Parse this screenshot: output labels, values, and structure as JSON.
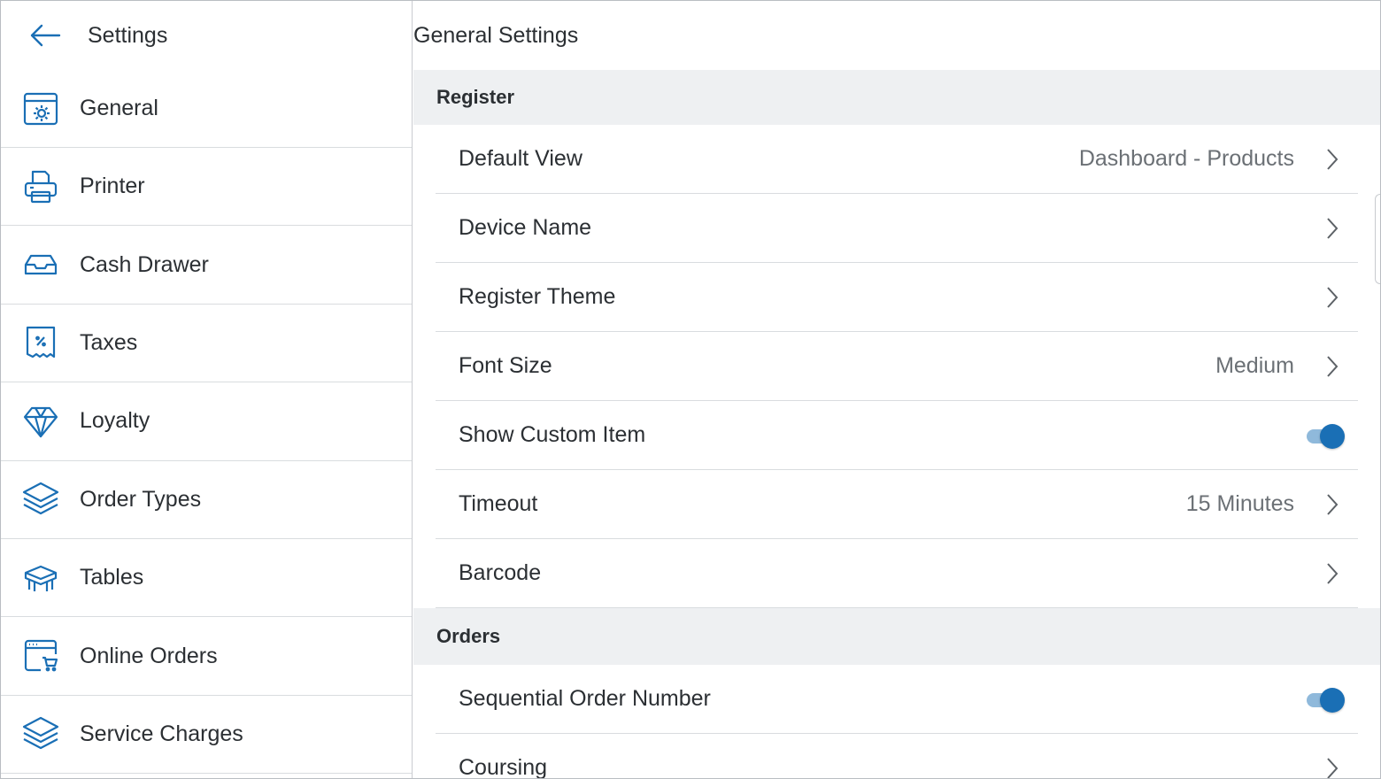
{
  "sidebar": {
    "title": "Settings",
    "items": [
      {
        "label": "General",
        "icon": "general-settings-icon"
      },
      {
        "label": "Printer",
        "icon": "printer-icon"
      },
      {
        "label": "Cash Drawer",
        "icon": "cash-drawer-icon"
      },
      {
        "label": "Taxes",
        "icon": "tax-receipt-icon"
      },
      {
        "label": "Loyalty",
        "icon": "diamond-icon"
      },
      {
        "label": "Order Types",
        "icon": "layers-icon"
      },
      {
        "label": "Tables",
        "icon": "table-icon"
      },
      {
        "label": "Online Orders",
        "icon": "online-cart-icon"
      },
      {
        "label": "Service Charges",
        "icon": "layers-icon"
      }
    ]
  },
  "main": {
    "title": "General Settings",
    "register": {
      "header": "Register",
      "rows": [
        {
          "label": "Default View",
          "value": "Dashboard - Products"
        },
        {
          "label": "Device Name",
          "value": ""
        },
        {
          "label": "Register Theme",
          "value": ""
        },
        {
          "label": "Font Size",
          "value": "Medium"
        },
        {
          "label": "Show Custom Item",
          "toggle": true
        },
        {
          "label": "Timeout",
          "value": "15 Minutes"
        },
        {
          "label": "Barcode",
          "value": ""
        }
      ]
    },
    "orders": {
      "header": "Orders",
      "rows": [
        {
          "label": "Sequential Order Number",
          "toggle": true
        },
        {
          "label": "Coursing",
          "value": ""
        }
      ]
    }
  },
  "colors": {
    "accent": "#1a6fb5",
    "toggle_track": "#8fb9db",
    "section_bg": "#eef0f2",
    "text": "#2b2f33",
    "muted_text": "#6b7075"
  }
}
